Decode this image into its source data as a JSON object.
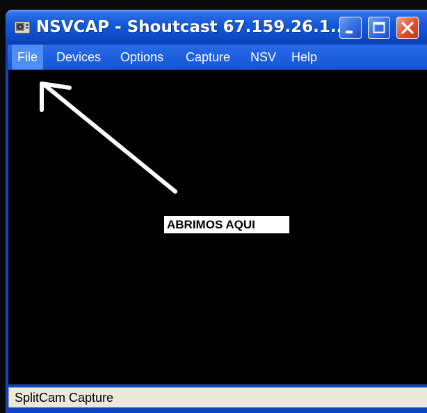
{
  "window": {
    "title": "NSVCAP - Shoutcast 67.159.26.1...",
    "app_icon": "camera-app-icon",
    "controls": {
      "minimize_icon": "minimize-icon",
      "maximize_icon": "maximize-icon",
      "close_icon": "close-icon"
    }
  },
  "menubar": {
    "items": [
      {
        "label": "File"
      },
      {
        "label": "Devices"
      },
      {
        "label": "Options"
      },
      {
        "label": "Capture"
      },
      {
        "label": "NSV"
      },
      {
        "label": "Help"
      }
    ]
  },
  "content": {
    "annotation": "ABRIMOS AQUI",
    "arrow_icon": "arrow-icon"
  },
  "statusbar": {
    "text": "SplitCam Capture"
  },
  "colors": {
    "titlebar": "#155ad6",
    "menubar": "#1456d8",
    "menu_selected": "#4d8df4",
    "content_bg": "#000000",
    "statusbar_bg": "#ece9d8",
    "close_button": "#e3502a"
  }
}
